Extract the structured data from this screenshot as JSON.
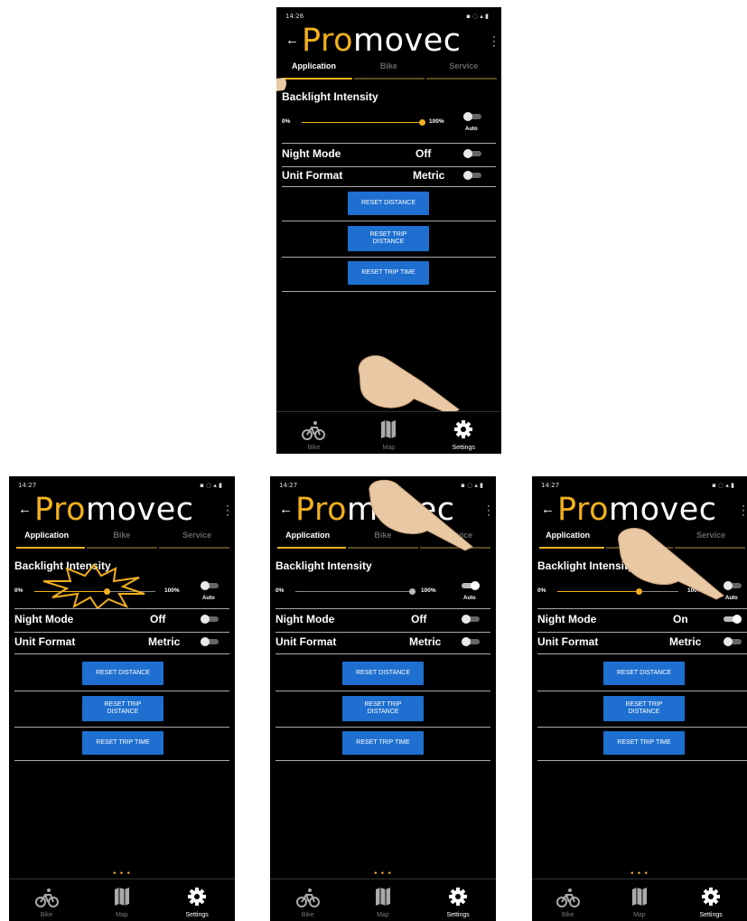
{
  "status_time_1": "14:26",
  "status_time_2": "14:27",
  "back": "←",
  "logo": {
    "pro": "Pro",
    "movec": "movec"
  },
  "tabs": [
    "Application",
    "Bike",
    "Service"
  ],
  "settings": {
    "backlight_label": "Backlight Intensity",
    "min": "0%",
    "max": "100%",
    "auto": "Auto",
    "night_mode_label": "Night Mode",
    "unit_format_label": "Unit Format",
    "unit_format_value": "Metric"
  },
  "buttons": {
    "reset_distance": "RESET DISTANCE",
    "reset_trip_line1": "RESET TRIP",
    "reset_trip_line2": "DISTANCE",
    "reset_trip_time": "RESET TRIP TIME"
  },
  "page_dots": "• • •",
  "nav": {
    "bike": "Bike",
    "map": "Map",
    "settings": "Settings"
  },
  "screens": [
    {
      "night_mode": "Off",
      "slider_fraction": 1.0,
      "auto_on": false
    },
    {
      "night_mode": "Off",
      "slider_fraction": 0.55,
      "auto_on": false
    },
    {
      "night_mode": "Off",
      "slider_fraction": 1.0,
      "auto_on": true
    },
    {
      "night_mode": "On",
      "slider_fraction": 0.62,
      "auto_on": false
    }
  ],
  "colors": {
    "accent": "#f2b01e",
    "button": "#1e6fcf",
    "background": "#000000"
  }
}
